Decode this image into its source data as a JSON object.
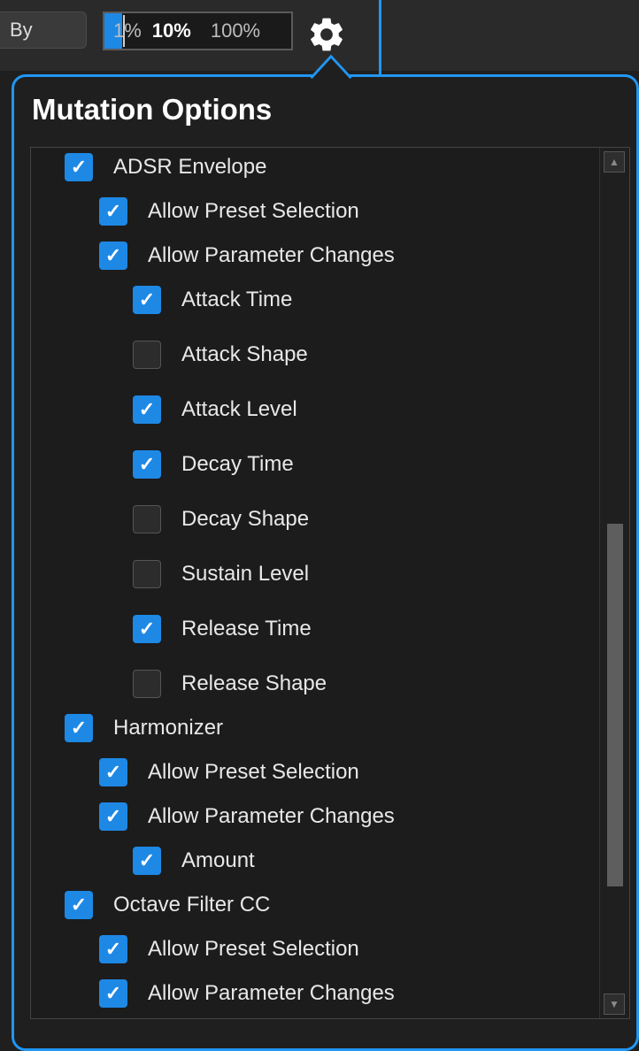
{
  "toolbar": {
    "by_label": "By",
    "percent_options": [
      "1%",
      "10%",
      "100%"
    ],
    "selected_percent": "10%",
    "icon": "gear-icon"
  },
  "popover": {
    "title": "Mutation Options",
    "options": [
      {
        "label": "ADSR Envelope",
        "level": 0,
        "checked": true
      },
      {
        "label": "Allow Preset Selection",
        "level": 1,
        "checked": true
      },
      {
        "label": "Allow Parameter Changes",
        "level": 1,
        "checked": true
      },
      {
        "label": "Attack Time",
        "level": 2,
        "checked": true
      },
      {
        "label": "Attack Shape",
        "level": 2,
        "checked": false
      },
      {
        "label": "Attack Level",
        "level": 2,
        "checked": true
      },
      {
        "label": "Decay Time",
        "level": 2,
        "checked": true
      },
      {
        "label": "Decay Shape",
        "level": 2,
        "checked": false
      },
      {
        "label": "Sustain Level",
        "level": 2,
        "checked": false
      },
      {
        "label": "Release Time",
        "level": 2,
        "checked": true
      },
      {
        "label": "Release Shape",
        "level": 2,
        "checked": false
      },
      {
        "label": "Harmonizer",
        "level": 0,
        "checked": true
      },
      {
        "label": "Allow Preset Selection",
        "level": 1,
        "checked": true
      },
      {
        "label": "Allow Parameter Changes",
        "level": 1,
        "checked": true
      },
      {
        "label": "Amount",
        "level": 2,
        "checked": true
      },
      {
        "label": "Octave Filter CC",
        "level": 0,
        "checked": true
      },
      {
        "label": "Allow Preset Selection",
        "level": 1,
        "checked": true
      },
      {
        "label": "Allow Parameter Changes",
        "level": 1,
        "checked": true
      }
    ]
  },
  "colors": {
    "accent": "#1e88e5",
    "panel_border": "#2196f3",
    "background": "#1f1f1f"
  }
}
